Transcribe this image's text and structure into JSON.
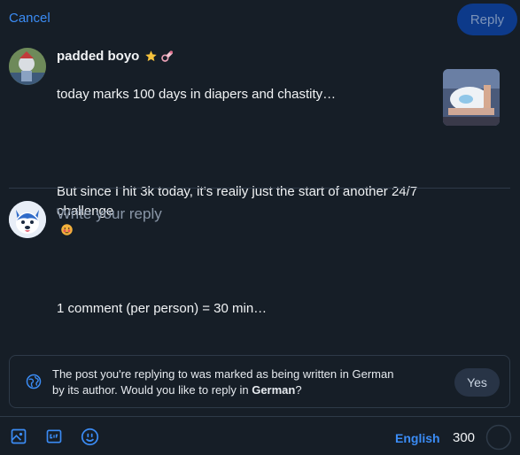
{
  "header": {
    "cancel_label": "Cancel",
    "reply_label": "Reply"
  },
  "post": {
    "author": "padded boyo",
    "badges": [
      "star-icon",
      "pacifier-icon"
    ],
    "text_line1": "today marks 100 days in diapers and chastity…",
    "text_line2": "But since I hit 3k today, it’s really just the start of another 24/7 challenge",
    "text_emoji": "flushed-face-icon",
    "text_line3": "1 comment (per person) = 30 min…"
  },
  "compose": {
    "placeholder": "Write your reply"
  },
  "language_notice": {
    "text_prefix": "The post you're replying to was marked as being written in German by its author. Would you like to reply in ",
    "language": "German",
    "text_suffix": "?",
    "yes_label": "Yes"
  },
  "toolbar": {
    "language_label": "English",
    "char_remaining": "300"
  },
  "colors": {
    "background": "#161e27",
    "accent": "#3b8cf5",
    "reply_button": "#0d3a8a"
  }
}
